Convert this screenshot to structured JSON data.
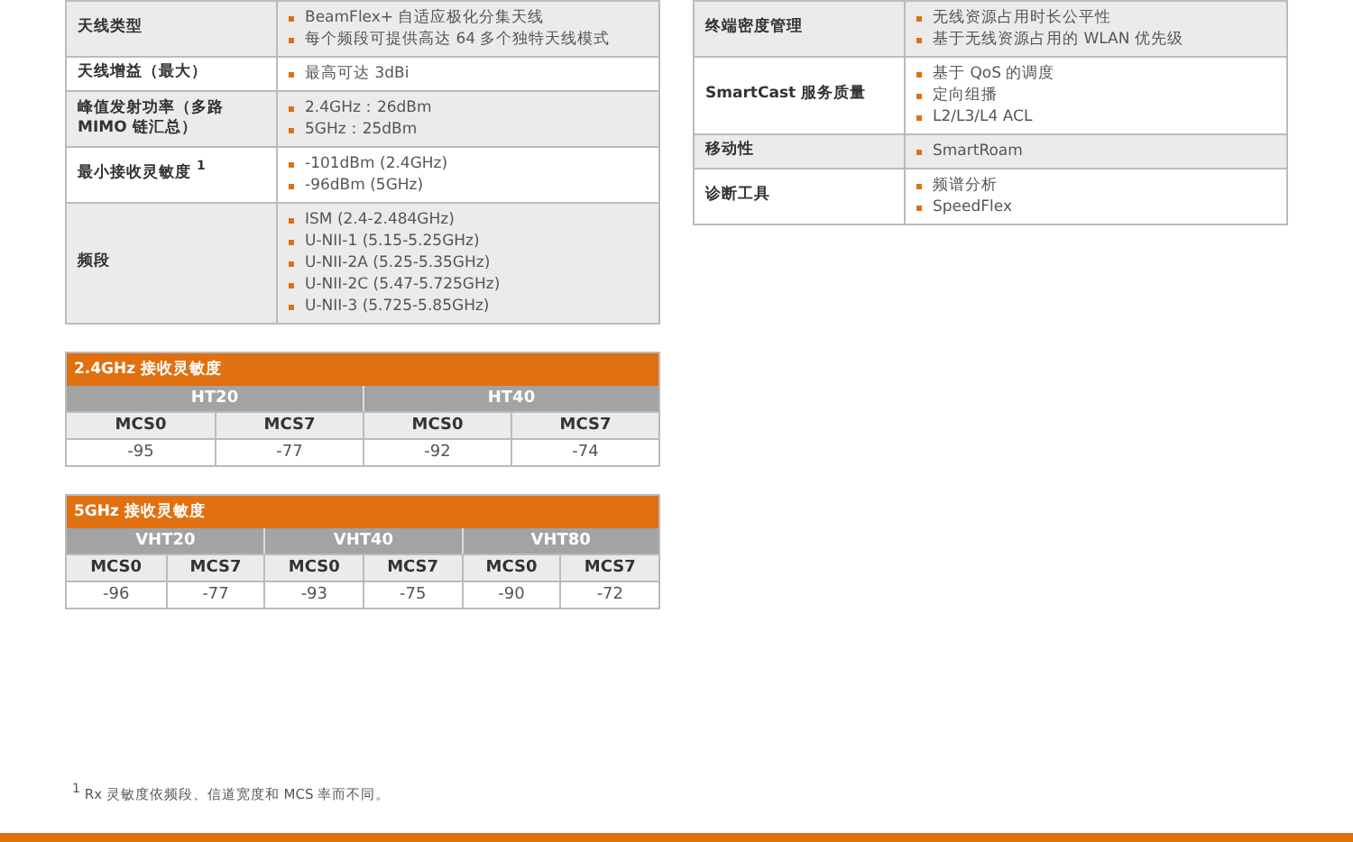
{
  "spec_left": [
    {
      "label": "天线类型",
      "items": [
        "BeamFlex+ 自适应极化分集天线",
        "每个频段可提供高达 64 多个独特天线模式"
      ]
    },
    {
      "label": "天线增益（最大）",
      "items": [
        "最高可达 3dBi"
      ]
    },
    {
      "label": "峰值发射功率（多路 MIMO 链汇总）",
      "items": [
        "2.4GHz：26dBm",
        "5GHz：25dBm"
      ]
    },
    {
      "label": "最小接收灵敏度 $^{1}$",
      "items": [
        "-101dBm (2.4GHz)",
        "-96dBm (5GHz)"
      ]
    },
    {
      "label": "频段",
      "items": [
        "ISM (2.4-2.484GHz)",
        "U-NII-1 (5.15-5.25GHz)",
        "U-NII-2A (5.25-5.35GHz)",
        "U-NII-2C (5.47-5.725GHz)",
        "U-NII-3 (5.725-5.85GHz)"
      ]
    }
  ],
  "spec_right": [
    {
      "label": "终端密度管理",
      "items": [
        "无线资源占用时长公平性",
        "基于无线资源占用的 WLAN 优先级"
      ]
    },
    {
      "label": "SmartCast 服务质量",
      "items": [
        "基于 QoS 的调度",
        "定向组播",
        "L2/L3/L4 ACL"
      ]
    },
    {
      "label": "移动性",
      "items": [
        "SmartRoam"
      ]
    },
    {
      "label": "诊断工具",
      "items": [
        "频谱分析",
        "SpeedFlex"
      ]
    }
  ],
  "sensitivity_tables": [
    {
      "title": "2.4GHz 接收灵敏度",
      "groups": [
        "HT20",
        "HT40"
      ],
      "columns": [
        "MCS0",
        "MCS7",
        "MCS0",
        "MCS7"
      ],
      "values": [
        "-95",
        "-77",
        "-92",
        "-74"
      ]
    },
    {
      "title": "5GHz 接收灵敏度",
      "groups": [
        "VHT20",
        "VHT40",
        "VHT80"
      ],
      "columns": [
        "MCS0",
        "MCS7",
        "MCS0",
        "MCS7",
        "MCS0",
        "MCS7"
      ],
      "values": [
        "-96",
        "-77",
        "-93",
        "-75",
        "-90",
        "-72"
      ]
    }
  ],
  "footnote": "$^{1}$ Rx 灵敏度依频段、信道宽度和 MCS 率而不同。"
}
